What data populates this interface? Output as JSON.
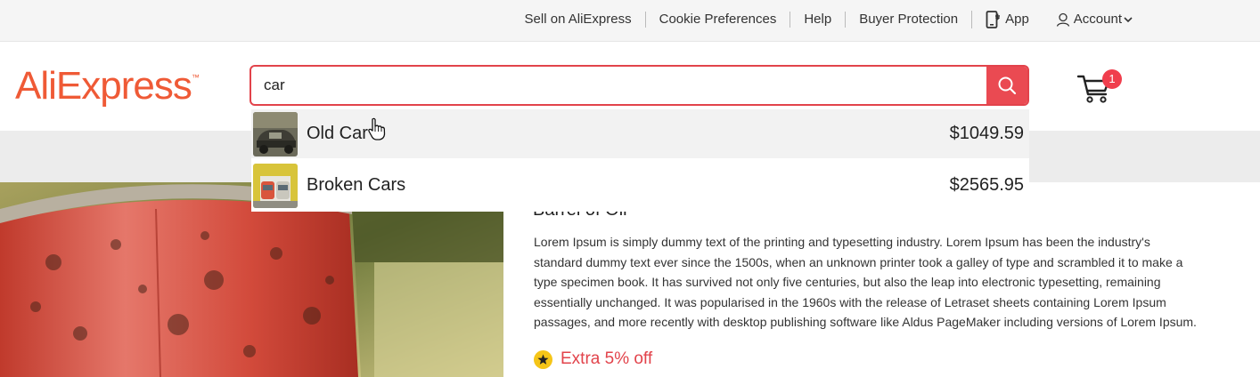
{
  "topbar": {
    "links": [
      {
        "label": "Sell on AliExpress"
      },
      {
        "label": "Cookie Preferences"
      },
      {
        "label": "Help"
      },
      {
        "label": "Buyer Protection"
      },
      {
        "label": "App",
        "icon": "phone-download-icon"
      },
      {
        "label": "Account",
        "icon": "user-icon"
      }
    ],
    "dropdown_icon": "chevron-down-icon"
  },
  "header": {
    "logo_text": "AliExpress",
    "logo_mark": "™",
    "search": {
      "value": "car",
      "button_icon": "search-icon"
    },
    "cart": {
      "icon": "cart-icon",
      "count": "1"
    }
  },
  "suggestions": [
    {
      "name": "Old Car",
      "price": "$1049.59",
      "thumb": "old-car-thumbnail"
    },
    {
      "name": "Broken Cars",
      "price": "$2565.95",
      "thumb": "broken-cars-thumbnail"
    }
  ],
  "product": {
    "title": "Barrel of Oil",
    "description_lines": [
      "Lorem Ipsum is simply dummy text of the printing and typesetting industry. Lorem Ipsum has been the industry's",
      "standard dummy text ever since the 1500s, when an unknown printer took a galley of type and scrambled it to make a",
      "type specimen book. It has survived not only five centuries, but also the leap into electronic typesetting, remaining",
      "essentially unchanged. It was popularised in the 1960s with the release of Letraset sheets containing Lorem Ipsum",
      "passages, and more recently with desktop publishing software like Aldus PageMaker including versions of Lorem Ipsum."
    ],
    "promo": "Extra 5% off"
  },
  "colors": {
    "brand": "#ef5a36",
    "accent": "#e2434b",
    "badge": "#f03e4d",
    "star": "#f5c518"
  }
}
